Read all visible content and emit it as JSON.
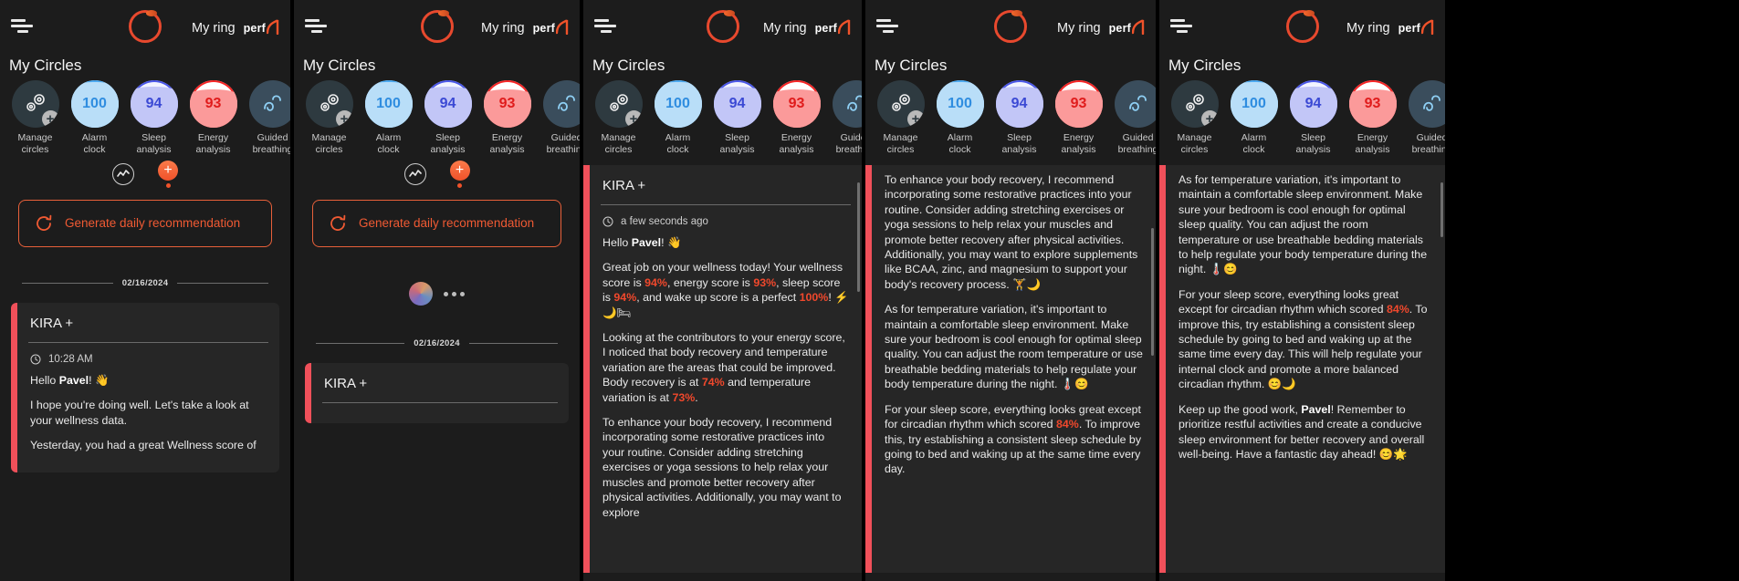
{
  "header": {
    "menu_icon": "hamburger-icon",
    "ring_icon": "ring-logo-icon",
    "title": "My ring",
    "brand": "perf"
  },
  "circles_section": {
    "title": "My Circles",
    "items": [
      {
        "label": "Manage\ncircles",
        "value": "",
        "icon": "gears-icon",
        "badge": "+",
        "type": "manage"
      },
      {
        "label": "Alarm\nclock",
        "value": "100",
        "fill": 88,
        "color": "#2f8de0",
        "bg": "#b9def8",
        "ring": "#4aa8f0"
      },
      {
        "label": "Sleep\nanalysis",
        "value": "94",
        "fill": 80,
        "color": "#3b49d4",
        "bg": "#c2c6f7",
        "ring": "#4a57e8"
      },
      {
        "label": "Energy\nanalysis",
        "value": "93",
        "fill": 72,
        "color": "#e01c1c",
        "bg": "#fb9a9a",
        "ring": "#f52525"
      },
      {
        "label": "Guided\nbreathing",
        "value": "",
        "icon": "breathing-icon",
        "color": "#4aa8f0",
        "bg": "#3a4d5c",
        "ring": "#4aa8f0"
      }
    ]
  },
  "actions": {
    "chart_icon": "chart-activity-icon",
    "add_icon": "plus-icon",
    "generate": {
      "icon": "refresh-icon",
      "label": "Generate daily\nrecommendation"
    }
  },
  "date_divider": "02/16/2024",
  "kira": {
    "title": "KIRA +",
    "clock_icon": "clock-icon",
    "time_panel1": "10:28 AM",
    "time_panel3": "a few seconds ago",
    "greeting": "Hello Pavel! 👋",
    "greeting_name": "Pavel",
    "p1_msg1": "I hope you're doing well. Let's take a look at your wellness data.",
    "p1_msg2": "Yesterday, you had a great Wellness score of",
    "p3_msg1_pre": "Great job on your wellness today! Your wellness score is ",
    "p3_wellness": "94%",
    "p3_mid1": ", energy score is ",
    "p3_energy": "93%",
    "p3_mid2": ", sleep score is ",
    "p3_sleep": "94%",
    "p3_mid3": ", and wake up score is a perfect ",
    "p3_wake": "100%",
    "p3_tail": "! ⚡🌙🛏",
    "p3_msg2_pre": "Looking at the contributors to your energy score, I noticed that body recovery and temperature variation are the areas that could be improved. Body recovery is at ",
    "p3_recovery": "74%",
    "p3_msg2_mid": " and temperature variation is at ",
    "p3_temp": "73%",
    "p3_msg2_tail": ".",
    "p3_msg3": "To enhance your body recovery, I recommend incorporating some restorative practices into your routine. Consider adding stretching exercises or yoga sessions to help relax your muscles and promote better recovery after physical activities. Additionally, you may want to explore",
    "p4_msg1": "To enhance your body recovery, I recommend incorporating some restorative practices into your routine. Consider adding stretching exercises or yoga sessions to help relax your muscles and promote better recovery after physical activities. Additionally, you may want to explore supplements like BCAA, zinc, and magnesium to support your body's recovery process. 🏋️🌙",
    "p4_msg2": "As for temperature variation, it's important to maintain a comfortable sleep environment. Make sure your bedroom is cool enough for optimal sleep quality. You can adjust the room temperature or use breathable bedding materials to help regulate your body temperature during the night. 🌡️😊",
    "p4_msg3_pre": "For your sleep score, everything looks great except for circadian rhythm which scored ",
    "p4_circadian": "84%",
    "p4_msg3_tail": ". To improve this, try establishing a consistent sleep schedule by going to bed and waking up at the same time every day.",
    "p5_msg1": "As for temperature variation, it's important to maintain a comfortable sleep environment. Make sure your bedroom is cool enough for optimal sleep quality. You can adjust the room temperature or use breathable bedding materials to help regulate your body temperature during the night. 🌡️😊",
    "p5_msg2_pre": "For your sleep score, everything looks great except for circadian rhythm which scored ",
    "p5_circadian": "84%",
    "p5_msg2_tail": ". To improve this, try establishing a consistent sleep schedule by going to bed and waking up at the same time every day. This will help regulate your internal clock and promote a more balanced circadian rhythm. 😊🌙",
    "p5_msg3_pre": "Keep up the good work, ",
    "p5_name": "Pavel",
    "p5_msg3_tail": "! Remember to prioritize restful activities and create a conducive sleep environment for better recovery and overall well-being. Have a fantastic day ahead! 😊🌟"
  },
  "colors": {
    "accent_orange": "#f05a33",
    "accent_red": "#f0505a",
    "bg": "#1c1c1c",
    "card": "#262626",
    "highlight": "#f0482c"
  }
}
